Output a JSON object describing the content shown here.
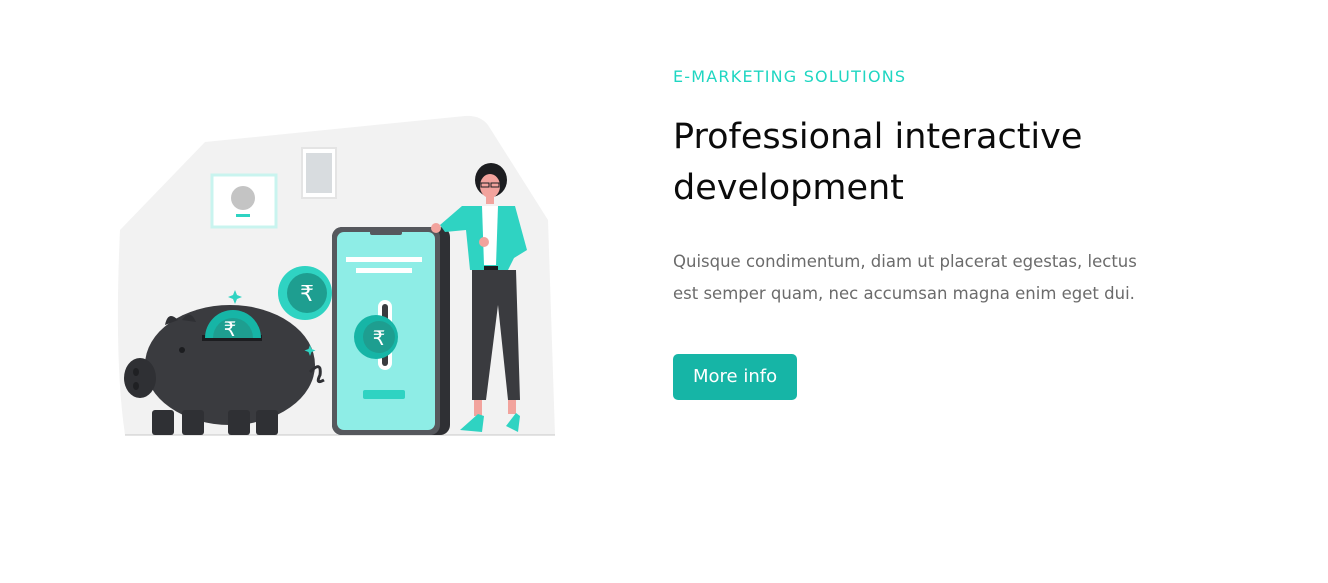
{
  "hero": {
    "eyebrow": "E-MARKETING SOLUTIONS",
    "title": "Professional interactive development",
    "description": "Quisque condimentum, diam ut placerat egestas, lectus est semper quam, nec accumsan magna enim eget dui.",
    "cta_label": "More info"
  },
  "illustration": {
    "currency_symbol": "₹"
  },
  "colors": {
    "accent": "#1fd6c2",
    "button": "#16b5a6",
    "title": "#0b0b0b",
    "body": "#6b6b6b",
    "phone_screen": "#8eede6",
    "piggy": "#3a3b3f"
  }
}
